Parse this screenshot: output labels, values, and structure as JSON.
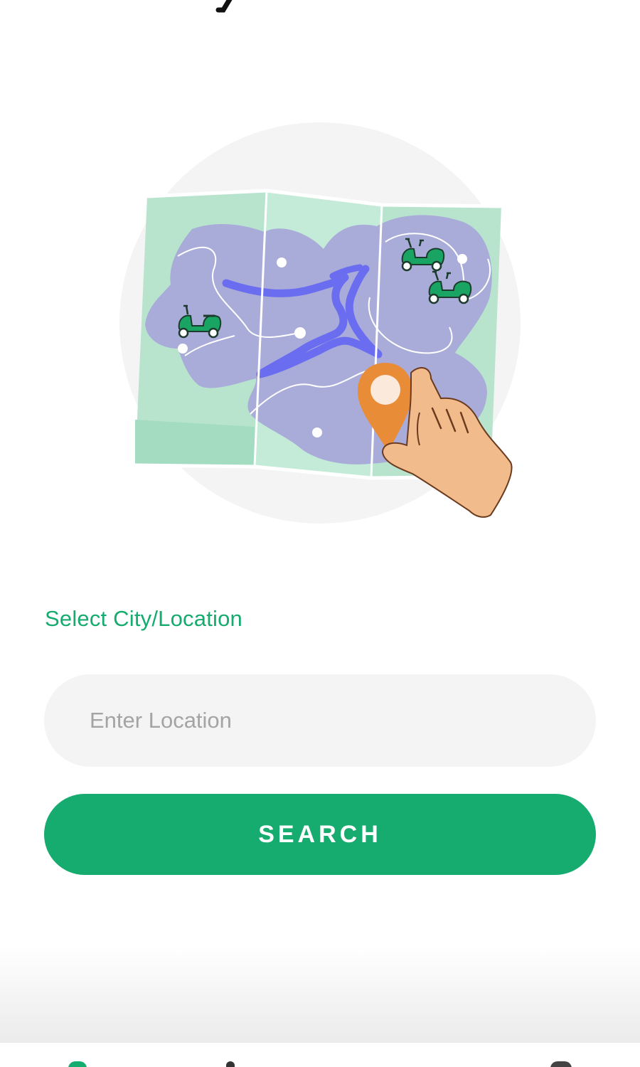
{
  "colors": {
    "brand": "#16ab6f",
    "input_background": "#f4f4f4",
    "placeholder": "#a4a4a4",
    "map_land": "#a9acd9",
    "map_river": "#6b6df0",
    "map_paper": "#bfe8d4",
    "pin": "#e98c37",
    "hand": "#f2bb8b"
  },
  "illustration": {
    "icons": [
      "map-icon",
      "scooter-icon",
      "location-pin-icon",
      "pointing-hand-icon"
    ]
  },
  "form": {
    "section_label": "Select City/Location",
    "location_placeholder": "Enter Location",
    "location_value": "",
    "search_label": "SEARCH"
  },
  "bottom_nav": {
    "icons": [
      "home-icon",
      "profile-icon",
      "support-icon"
    ]
  }
}
